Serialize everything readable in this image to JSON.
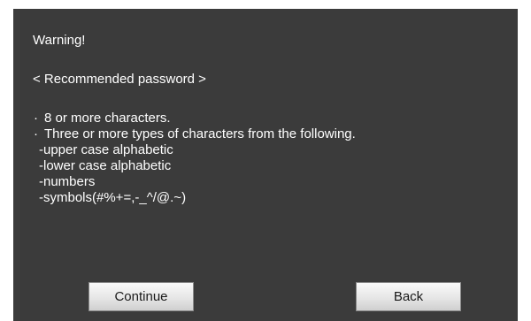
{
  "dialog": {
    "title": "Warning!",
    "subtitle": "< Recommended password >",
    "requirements": [
      {
        "bullet": "·",
        "text": "8 or more characters."
      },
      {
        "bullet": "·",
        "text": "Three or more types of characters from the following."
      }
    ],
    "character_types": [
      "-upper case alphabetic",
      "-lower case alphabetic",
      "-numbers",
      "-symbols(#%+=,-_^/@.~)"
    ],
    "buttons": {
      "continue_label": "Continue",
      "back_label": "Back"
    }
  },
  "colors": {
    "dialog_background": "#3b3b3b",
    "text": "#ffffff",
    "page_background": "#ffffff"
  }
}
